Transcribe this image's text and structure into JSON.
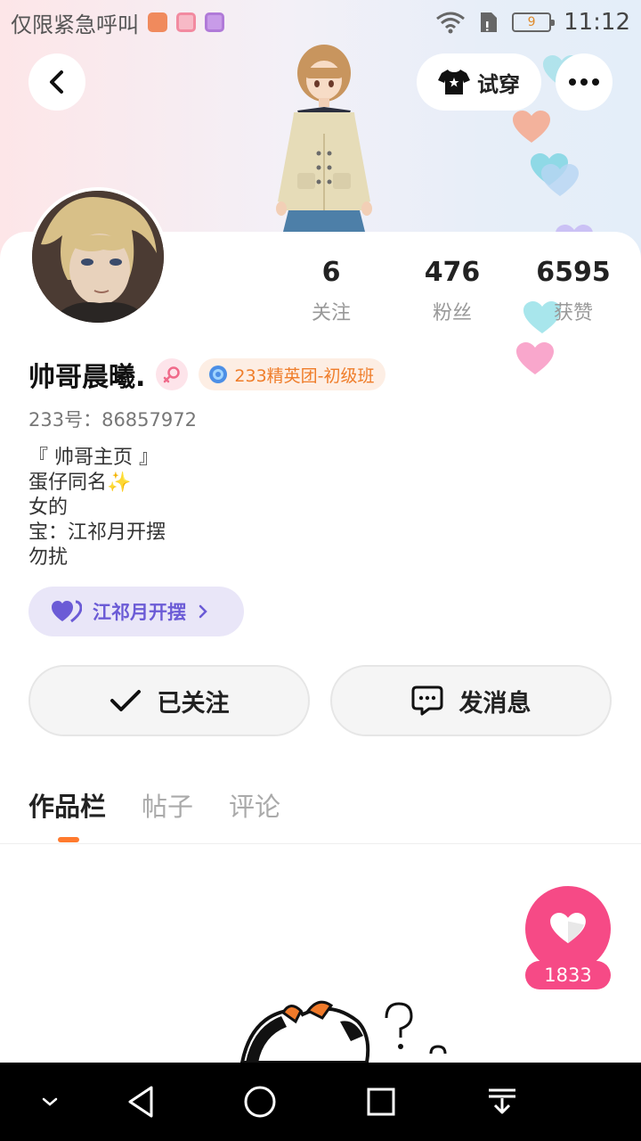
{
  "status_bar": {
    "carrier_text": "仅限紧急呼叫",
    "battery_level": "9",
    "time": "11:12"
  },
  "header": {
    "tryon_label": "试穿"
  },
  "profile": {
    "stats": [
      {
        "value": "6",
        "label": "关注"
      },
      {
        "value": "476",
        "label": "粉丝"
      },
      {
        "value": "6595",
        "label": "获赞"
      }
    ],
    "username": "帅哥晨曦.",
    "level_badge": "233精英团-初级班",
    "uid_line": "233号：86857972",
    "bio_lines": [
      "『 帅哥主页 』",
      "蛋仔同名✨",
      "女的",
      "宝：江祁月开摆",
      "勿扰"
    ],
    "tag_pill": "江祁月开摆"
  },
  "actions": {
    "follow_label": "已关注",
    "message_label": "发消息"
  },
  "tabs": [
    {
      "label": "作品栏",
      "active": true
    },
    {
      "label": "帖子",
      "active": false
    },
    {
      "label": "评论",
      "active": false
    }
  ],
  "like": {
    "count": "1833"
  },
  "colors": {
    "accent": "#ff7a2e",
    "like_pink": "#f64a86",
    "tag_purple": "#6b5bd6",
    "level_orange": "#ef7d2a"
  },
  "icons": {
    "back": "chevron-left-icon",
    "tryon": "tshirt-icon",
    "more": "more-dots-icon",
    "follow": "check-icon",
    "message": "chat-bubble-icon"
  }
}
